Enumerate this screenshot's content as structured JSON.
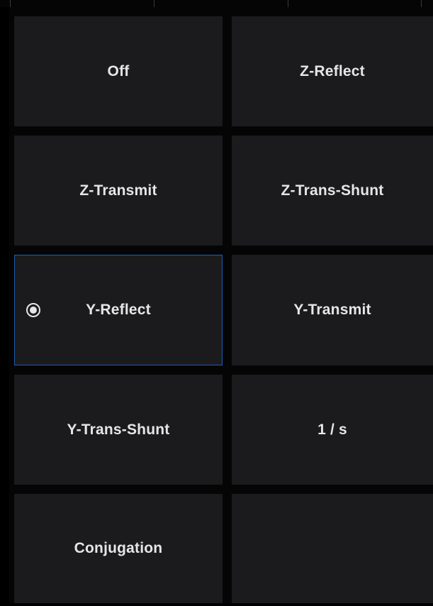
{
  "menu": {
    "selected_index": 4,
    "items": [
      {
        "label": "Off"
      },
      {
        "label": "Z-Reflect"
      },
      {
        "label": "Z-Transmit"
      },
      {
        "label": "Z-Trans-Shunt"
      },
      {
        "label": "Y-Reflect"
      },
      {
        "label": "Y-Transmit"
      },
      {
        "label": "Y-Trans-Shunt"
      },
      {
        "label": "1 / s"
      },
      {
        "label": "Conjugation"
      }
    ]
  },
  "colors": {
    "background": "#0b0b0b",
    "button": "#1b1b1d",
    "text": "#e6e6e6",
    "selected_border": "#1f5fb0"
  },
  "icons": {
    "selected_indicator": "radio-selected-icon"
  }
}
